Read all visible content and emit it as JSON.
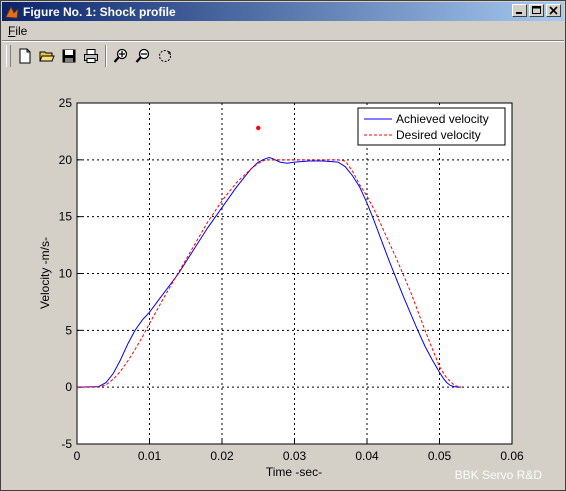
{
  "window": {
    "title": "Figure No. 1: Shock profile",
    "controls": [
      "minimize-icon",
      "maximize-icon",
      "close-icon"
    ]
  },
  "menu": {
    "file_label": "File",
    "file_mnemonic": "F",
    "file_rest": "ile"
  },
  "toolbar": {
    "icons": [
      "new-icon",
      "open-icon",
      "save-icon",
      "print-icon",
      "zoom-in-icon",
      "zoom-out-icon",
      "rotate-icon"
    ]
  },
  "watermark": "BBK Servo R&D",
  "chart_data": {
    "type": "line",
    "title": "",
    "xlabel": "Time -sec-",
    "ylabel": "Velocity -m/s-",
    "xlim": [
      0,
      0.06
    ],
    "ylim": [
      -5,
      25
    ],
    "xticks": [
      0,
      0.01,
      0.02,
      0.03,
      0.04,
      0.05,
      0.06
    ],
    "xtick_labels": [
      "0",
      "0.01",
      "0.02",
      "0.03",
      "0.04",
      "0.05",
      "0.06"
    ],
    "yticks": [
      -5,
      0,
      5,
      10,
      15,
      20,
      25
    ],
    "ytick_labels": [
      "-5",
      "0",
      "5",
      "10",
      "15",
      "20",
      "25"
    ],
    "grid": true,
    "grid_style": "dashed",
    "legend_position": "top-right",
    "series": [
      {
        "name": "Achieved velocity",
        "color": "#0000ff",
        "style": "solid",
        "x": [
          0,
          0.003,
          0.004,
          0.005,
          0.006,
          0.007,
          0.008,
          0.009,
          0.01,
          0.012,
          0.014,
          0.016,
          0.018,
          0.02,
          0.022,
          0.024,
          0.025,
          0.026,
          0.0265,
          0.027,
          0.028,
          0.029,
          0.03,
          0.032,
          0.034,
          0.036,
          0.037,
          0.038,
          0.039,
          0.04,
          0.041,
          0.042,
          0.043,
          0.044,
          0.045,
          0.046,
          0.047,
          0.048,
          0.049,
          0.05,
          0.0505,
          0.051,
          0.0515,
          0.052,
          0.0525,
          0.053
        ],
        "y": [
          0,
          0.05,
          0.4,
          1.2,
          2.4,
          3.8,
          5.0,
          5.9,
          6.6,
          8.3,
          10.0,
          12.0,
          14.0,
          15.8,
          17.6,
          19.2,
          19.8,
          20.1,
          20.2,
          20.1,
          19.8,
          19.7,
          19.8,
          19.9,
          19.9,
          19.8,
          19.4,
          18.6,
          17.6,
          16.2,
          14.6,
          12.9,
          11.2,
          9.6,
          8.0,
          6.5,
          5.0,
          3.6,
          2.4,
          1.3,
          0.8,
          0.4,
          0.15,
          0.05,
          0.0,
          0.0
        ]
      },
      {
        "name": "Desired velocity",
        "color": "#ff0000",
        "style": "dashed",
        "x": [
          0,
          0.003,
          0.004,
          0.005,
          0.006,
          0.007,
          0.008,
          0.009,
          0.01,
          0.012,
          0.014,
          0.016,
          0.018,
          0.02,
          0.022,
          0.024,
          0.025,
          0.026,
          0.027,
          0.028,
          0.03,
          0.032,
          0.034,
          0.036,
          0.037,
          0.038,
          0.039,
          0.04,
          0.041,
          0.042,
          0.044,
          0.046,
          0.048,
          0.049,
          0.05,
          0.051,
          0.052,
          0.0525,
          0.053
        ],
        "y": [
          0,
          0.0,
          0.2,
          0.7,
          1.4,
          2.3,
          3.3,
          4.4,
          5.6,
          7.9,
          10.1,
          12.3,
          14.5,
          16.4,
          18.0,
          19.2,
          19.7,
          20.0,
          20.0,
          20.0,
          20.0,
          20.0,
          20.0,
          20.0,
          19.9,
          19.0,
          17.8,
          16.8,
          15.6,
          14.2,
          11.4,
          8.4,
          5.0,
          3.4,
          1.8,
          0.8,
          0.2,
          0.05,
          0.0
        ]
      }
    ],
    "annotations": [
      {
        "type": "marker",
        "x": 0.025,
        "y": 22.8,
        "color": "#ff0000"
      }
    ]
  }
}
